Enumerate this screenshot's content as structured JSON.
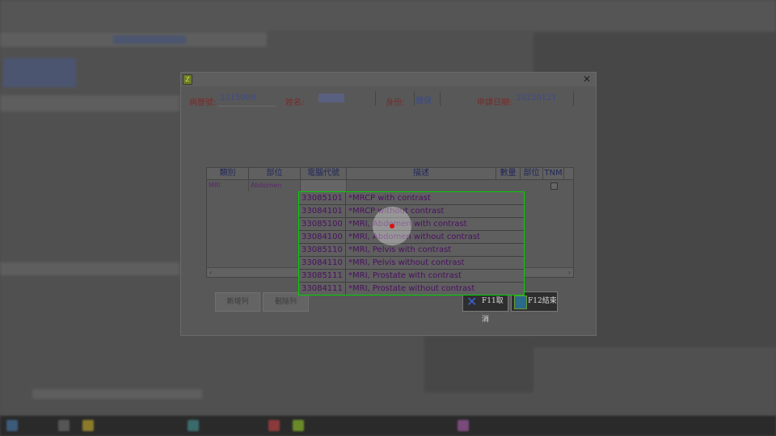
{
  "dialog": {
    "labels": {
      "chart_no": "病歷號:",
      "name": "姓名:",
      "identity": "身份:",
      "apply_date": "申請日期:"
    },
    "values": {
      "chart_no": "2315009",
      "name": "",
      "identity": "健保",
      "apply_date": "20220121"
    },
    "grid": {
      "headers": [
        "類別",
        "部位",
        "電腦代號",
        "描述",
        "數量",
        "部位",
        "TNM"
      ],
      "row": {
        "category": "MRI",
        "site": "Abdomen"
      }
    },
    "buttons": {
      "add_row": "新增列",
      "delete_row": "刪除列",
      "f11": "F11取消",
      "f12": "F12結束"
    }
  },
  "popup": {
    "items": [
      {
        "code": "33085101",
        "desc": "*MRCP with contrast"
      },
      {
        "code": "33084101",
        "desc": "*MRCP without contrast"
      },
      {
        "code": "33085100",
        "desc": "*MRI, Abdomen with contrast"
      },
      {
        "code": "33084100",
        "desc": "*MRI, Abdomen without contrast"
      },
      {
        "code": "33085110",
        "desc": "*MRI, Pelvis with contrast"
      },
      {
        "code": "33084110",
        "desc": "*MRI, Pelvis without contrast"
      },
      {
        "code": "33085111",
        "desc": "*MRI, Prostate with contrast"
      },
      {
        "code": "33084111",
        "desc": "*MRI, Prostate without contrast"
      }
    ]
  },
  "icons": {
    "app": "app-icon",
    "close": "close-icon",
    "f11": "x-icon",
    "f12": "exit-icon",
    "scroll_left": "arrow-left-icon",
    "scroll_right": "arrow-right-icon"
  },
  "colors": {
    "popup_border": "#00d000",
    "label_text": "#7a2a2a",
    "value_text": "#3a4a8a",
    "popup_text": "#4a1060",
    "cursor": "#e01010"
  }
}
